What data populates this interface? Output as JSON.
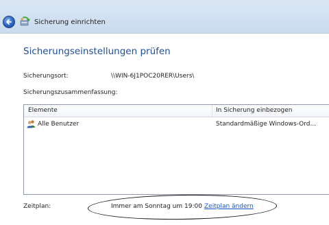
{
  "window": {
    "title": "Sicherung einrichten",
    "back_icon": "back-arrow-icon",
    "app_icon": "backup-icon"
  },
  "main": {
    "heading": "Sicherungseinstellungen prüfen",
    "location_label": "Sicherungsort:",
    "location_value": "\\\\WIN-6J1POC20RER\\Users\\",
    "summary_label": "Sicherungszusammenfassung:"
  },
  "table": {
    "columns": [
      "Elemente",
      "In Sicherung einbezogen"
    ],
    "rows": [
      {
        "icon": "users-icon",
        "item": "Alle Benutzer",
        "included": "Standardmäßige Windows-Ord..."
      }
    ]
  },
  "schedule": {
    "label": "Zeitplan:",
    "value": "Immer am Sonntag um 19:00",
    "change_link": "Zeitplan ändern"
  },
  "colors": {
    "heading": "#1f4e9a",
    "link": "#1a56c9",
    "topbar": "#d2e1f2"
  }
}
